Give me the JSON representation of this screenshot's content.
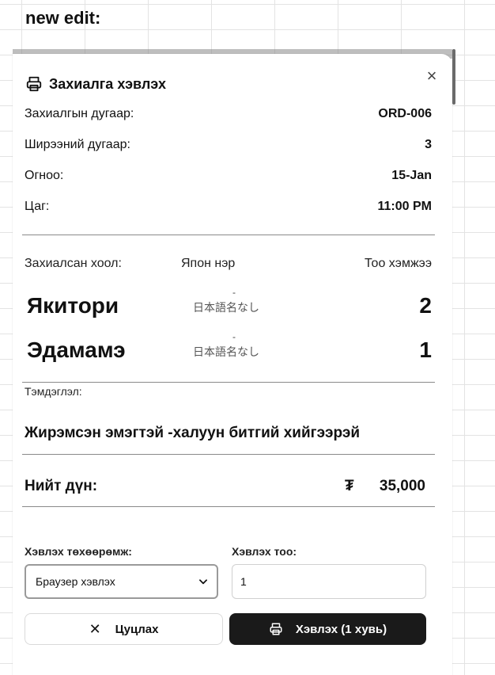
{
  "sheet": {
    "title": "new edit:"
  },
  "dialog": {
    "title": "Захиалга хэвлэх",
    "close_symbol": "×",
    "info": [
      {
        "label": "Захиалгын дугаар:",
        "value": "ORD-006"
      },
      {
        "label": "Ширээний дугаар:",
        "value": "3"
      },
      {
        "label": "Огноо:",
        "value": "15-Jan"
      },
      {
        "label": "Цаг:",
        "value": "11:00 PM"
      }
    ],
    "items_header": {
      "food": "Захиалсан хоол:",
      "japanese": "Япон нэр",
      "qty": "Тоо хэмжээ"
    },
    "items": [
      {
        "name": "Якитори",
        "dot": "-",
        "jp": "日本語名なし",
        "qty": "2"
      },
      {
        "name": "Эдамамэ",
        "dot": "-",
        "jp": "日本語名なし",
        "qty": "1"
      }
    ],
    "note": {
      "label": "Тэмдэглэл:",
      "text": "Жирэмсэн эмэгтэй -халуун битгий хийгээрэй"
    },
    "total": {
      "label": "Нийт дүн:",
      "currency": "₮",
      "amount": "35,000"
    },
    "form": {
      "device_label": "Хэвлэх төхөөрөмж:",
      "device_value": "Браузер хэвлэх",
      "copies_label": "Хэвлэх тоо:",
      "copies_value": "1"
    },
    "buttons": {
      "cancel": "Цуцлах",
      "print": "Хэвлэх (1 хувь)"
    }
  },
  "icons": {
    "print": "printer-icon",
    "close": "close-icon",
    "chevron": "chevron-down-icon"
  },
  "colors": {
    "primary_button": "#1a1a1a",
    "divider": "#8a8a8a"
  }
}
